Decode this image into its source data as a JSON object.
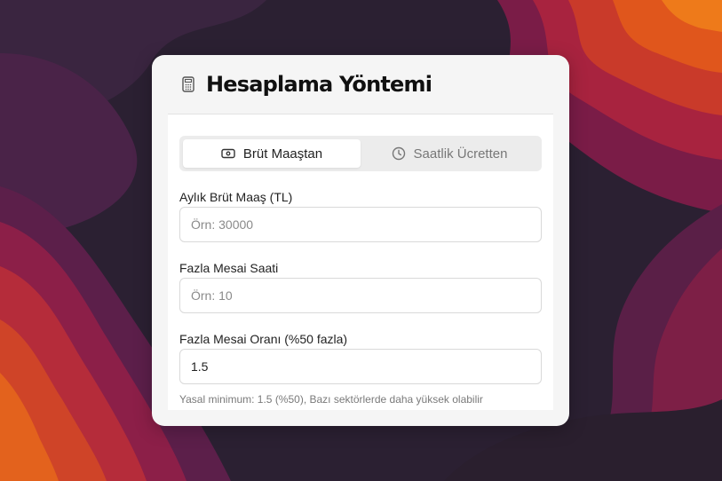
{
  "card": {
    "title": "Hesaplama Yöntemi",
    "title_icon": "calculator-icon"
  },
  "tabs": [
    {
      "label": "Brüt Maaştan",
      "icon": "money-icon",
      "active": true
    },
    {
      "label": "Saatlik Ücretten",
      "icon": "clock-icon",
      "active": false
    }
  ],
  "fields": {
    "gross_salary": {
      "label": "Aylık Brüt Maaş (TL)",
      "placeholder": "Örn: 30000",
      "value": ""
    },
    "overtime_hours": {
      "label": "Fazla Mesai Saati",
      "placeholder": "Örn: 10",
      "value": ""
    },
    "overtime_rate": {
      "label": "Fazla Mesai Oranı (%50 fazla)",
      "placeholder": "",
      "value": "1.5"
    }
  },
  "hint": "Yasal minimum: 1.5 (%50), Bazı sektörlerde daha yüksek olabilir",
  "colors": {
    "background_dark": "#2a2030",
    "background_orange": "#d9481e",
    "background_magenta": "#9c1f4e",
    "card": "#f5f5f5"
  }
}
